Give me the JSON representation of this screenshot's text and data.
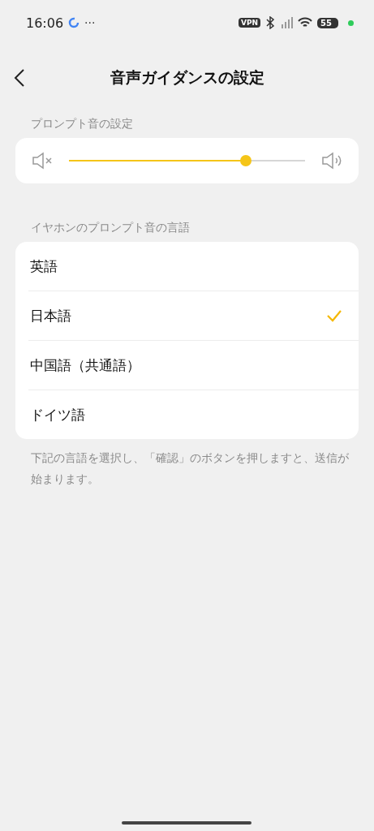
{
  "status_bar": {
    "time": "16:06",
    "more": "···",
    "vpn": "VPN",
    "battery": "55"
  },
  "header": {
    "title": "音声ガイダンスの設定"
  },
  "prompt_section": {
    "label": "プロンプト音の設定",
    "volume": {
      "level": 0.75
    }
  },
  "language_section": {
    "label": "イヤホンのプロンプト音の言語",
    "languages": [
      {
        "label": "英語",
        "selected": false
      },
      {
        "label": "日本語",
        "selected": true
      },
      {
        "label": "中国語（共通語）",
        "selected": false
      },
      {
        "label": "ドイツ語",
        "selected": false
      }
    ],
    "note": "下記の言語を選択し、「確認」のボタンを押しますと、送信が始まります。"
  }
}
